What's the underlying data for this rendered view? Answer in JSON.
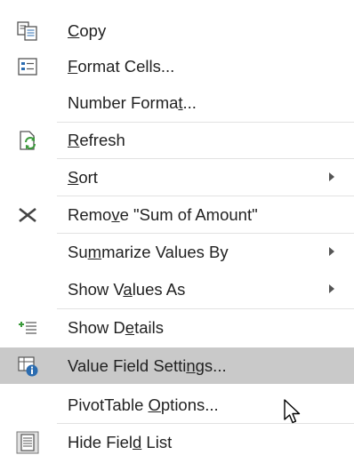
{
  "menu": {
    "items": [
      {
        "name": "copy",
        "label_pre": "",
        "label_key": "C",
        "label_post": "opy"
      },
      {
        "name": "format-cells",
        "label_pre": "",
        "label_key": "F",
        "label_post": "ormat Cells..."
      },
      {
        "name": "number-format",
        "label_pre": "Number Forma",
        "label_key": "t",
        "label_post": "..."
      },
      {
        "name": "refresh",
        "label_pre": "",
        "label_key": "R",
        "label_post": "efresh"
      },
      {
        "name": "sort",
        "label_pre": "",
        "label_key": "S",
        "label_post": "ort"
      },
      {
        "name": "remove-sum-of-amount",
        "label_pre": "Remo",
        "label_key": "v",
        "label_post": "e \"Sum of Amount\""
      },
      {
        "name": "summarize-values-by",
        "label_pre": "Su",
        "label_key": "m",
        "label_post": "marize Values By"
      },
      {
        "name": "show-values-as",
        "label_pre": "Show V",
        "label_key": "a",
        "label_post": "lues As"
      },
      {
        "name": "show-details",
        "label_pre": "Show D",
        "label_key": "e",
        "label_post": "tails"
      },
      {
        "name": "value-field-settings",
        "label_pre": "Value Field Setti",
        "label_key": "n",
        "label_post": "gs..."
      },
      {
        "name": "pivottable-options",
        "label_pre": "PivotTable ",
        "label_key": "O",
        "label_post": "ptions..."
      },
      {
        "name": "hide-field-list",
        "label_pre": "Hide Fiel",
        "label_key": "d",
        "label_post": " List"
      }
    ],
    "icons": {
      "copy": "copy-icon",
      "format-cells": "format-cells-icon",
      "refresh": "refresh-icon",
      "remove": "remove-x-icon",
      "show-details": "show-details-icon",
      "value-field-settings": "value-field-settings-icon",
      "hide-field-list": "field-list-icon",
      "submenu": "submenu-arrow-icon",
      "cursor": "mouse-pointer-icon"
    },
    "highlighted_item": "value-field-settings",
    "colors": {
      "highlight": "#c9c9c9",
      "text": "#222222",
      "separator": "#e2e2e2",
      "icon_blue": "#2b6cb0",
      "icon_green": "#3a9a3a"
    }
  }
}
